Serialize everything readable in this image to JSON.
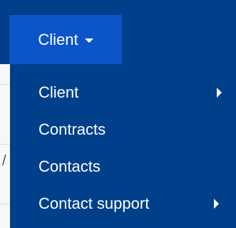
{
  "nav": {
    "client_tab_label": "Client",
    "accent_color": "#0c55c8",
    "menu_bg_color": "#00408a"
  },
  "menu": {
    "items": [
      {
        "label": "Client",
        "has_submenu": true
      },
      {
        "label": "Contracts",
        "has_submenu": false
      },
      {
        "label": "Contacts",
        "has_submenu": false
      },
      {
        "label": "Contact support",
        "has_submenu": true
      }
    ]
  },
  "background": {
    "partial_text": "/"
  }
}
